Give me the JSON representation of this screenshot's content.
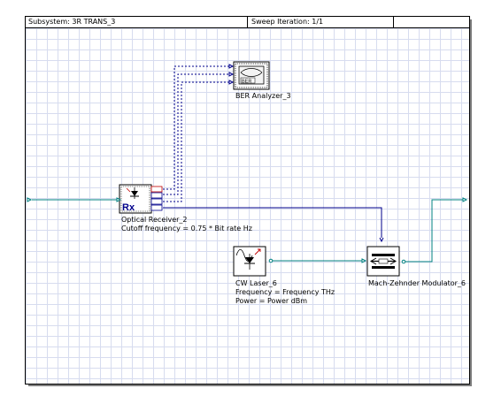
{
  "header": {
    "subsystem": "Subsystem: 3R TRANS_3",
    "sweep": "Sweep Iteration: 1/1"
  },
  "components": {
    "ber_analyzer": {
      "name": "BER Analyzer_3",
      "icon_text": "BER"
    },
    "optical_receiver": {
      "icon_text": "Rx",
      "name": "Optical Receiver_2",
      "param": "Cutoff frequency = 0.75 * Bit rate  Hz"
    },
    "cw_laser": {
      "name": "CW Laser_6",
      "param1": "Frequency = Frequency  THz",
      "param2": "Power = Power  dBm"
    },
    "mz_modulator": {
      "name": "Mach-Zehnder Modulator_6"
    }
  },
  "colors": {
    "optical": "#008080",
    "electrical": "#00008b",
    "grid": "#d7dcef"
  },
  "icons": [
    "photodiode-icon",
    "eye-diagram-icon",
    "laser-diode-icon",
    "modulator-icon"
  ]
}
